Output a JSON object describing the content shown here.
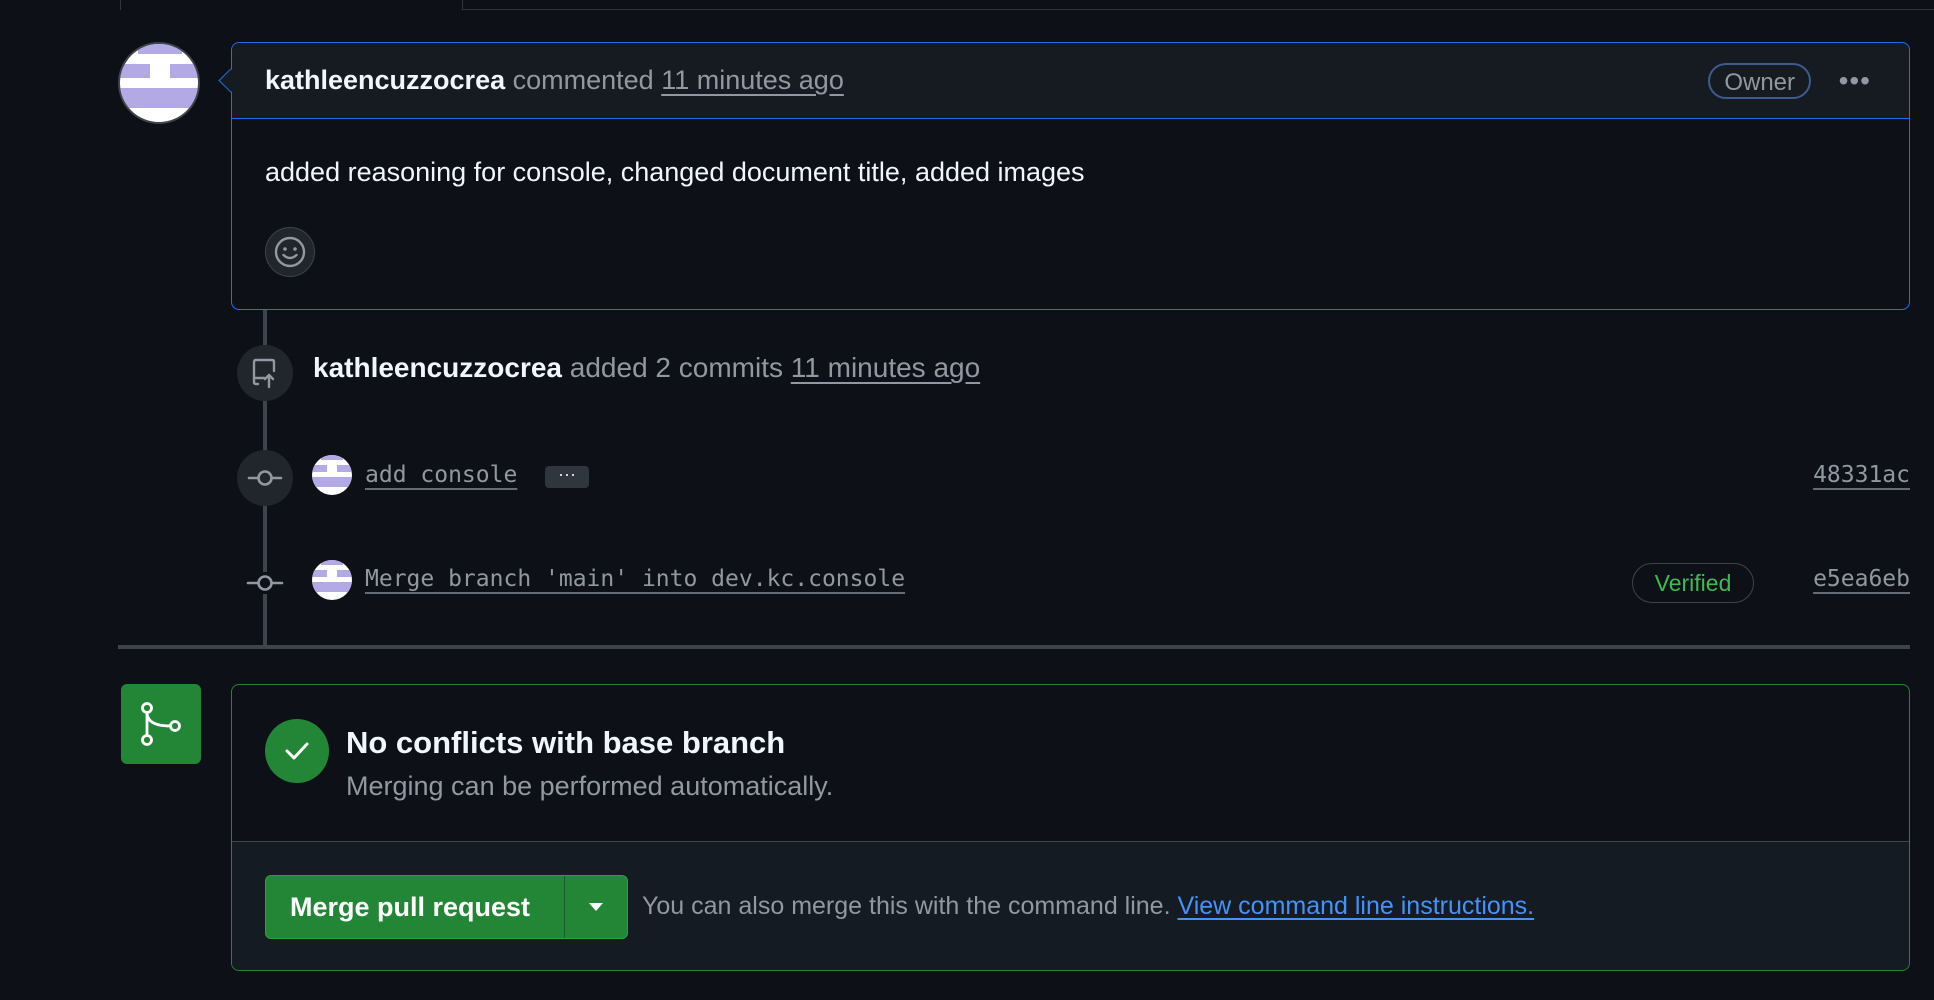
{
  "comment": {
    "author": "kathleencuzzocrea",
    "action": "commented",
    "time": "11 minutes ago",
    "role_badge": "Owner",
    "body": "added reasoning for console, changed document title, added images"
  },
  "commit_event": {
    "author": "kathleencuzzocrea",
    "action": "added 2 commits",
    "time": "11 minutes ago"
  },
  "commits": [
    {
      "message": "add console",
      "sha": "48331ac",
      "more_label": "···",
      "verified": ""
    },
    {
      "message": "Merge branch 'main' into dev.kc.console",
      "sha": "e5ea6eb",
      "verified": "Verified"
    }
  ],
  "merge": {
    "title": "No conflicts with base branch",
    "subtitle": "Merging can be performed automatically.",
    "button_label": "Merge pull request",
    "hint_text": "You can also merge this with the command line.",
    "hint_link": "View command line instructions."
  },
  "colors": {
    "accent_blue": "#1f6feb",
    "success_green": "#238636",
    "link_blue": "#4493f8"
  }
}
